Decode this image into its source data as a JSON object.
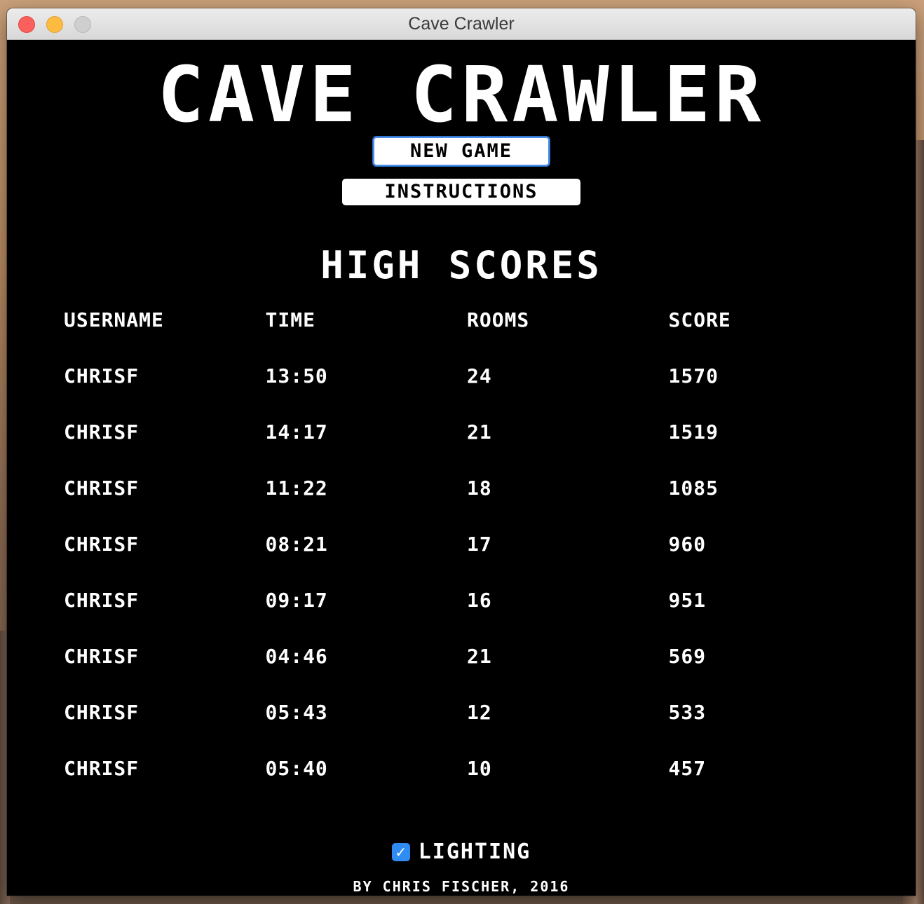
{
  "window": {
    "title": "Cave Crawler"
  },
  "game": {
    "title": "CAVE CRAWLER",
    "new_game_label": "NEW GAME",
    "instructions_label": "INSTRUCTIONS",
    "high_scores_heading": "HIGH SCORES",
    "columns": [
      "USERNAME",
      "TIME",
      "ROOMS",
      "SCORE"
    ],
    "rows": [
      [
        "CHRISF",
        "13:50",
        "24",
        "1570"
      ],
      [
        "CHRISF",
        "14:17",
        "21",
        "1519"
      ],
      [
        "CHRISF",
        "11:22",
        "18",
        "1085"
      ],
      [
        "CHRISF",
        "08:21",
        "17",
        "960"
      ],
      [
        "CHRISF",
        "09:17",
        "16",
        "951"
      ],
      [
        "CHRISF",
        "04:46",
        "21",
        "569"
      ],
      [
        "CHRISF",
        "05:43",
        "12",
        "533"
      ],
      [
        "CHRISF",
        "05:40",
        "10",
        "457"
      ]
    ],
    "lighting": {
      "label": "LIGHTING",
      "checked": true,
      "check_glyph": "✓"
    },
    "credit": "BY CHRIS FISCHER, 2016"
  },
  "colors": {
    "background": "#000000",
    "text": "#ffffff",
    "checkbox_accent": "#2f8cf5",
    "focus_ring": "#4a8ee6"
  },
  "icons": {
    "close": "close-icon",
    "minimize": "minimize-icon",
    "maximize": "maximize-icon",
    "checkbox": "checkmark-icon"
  }
}
